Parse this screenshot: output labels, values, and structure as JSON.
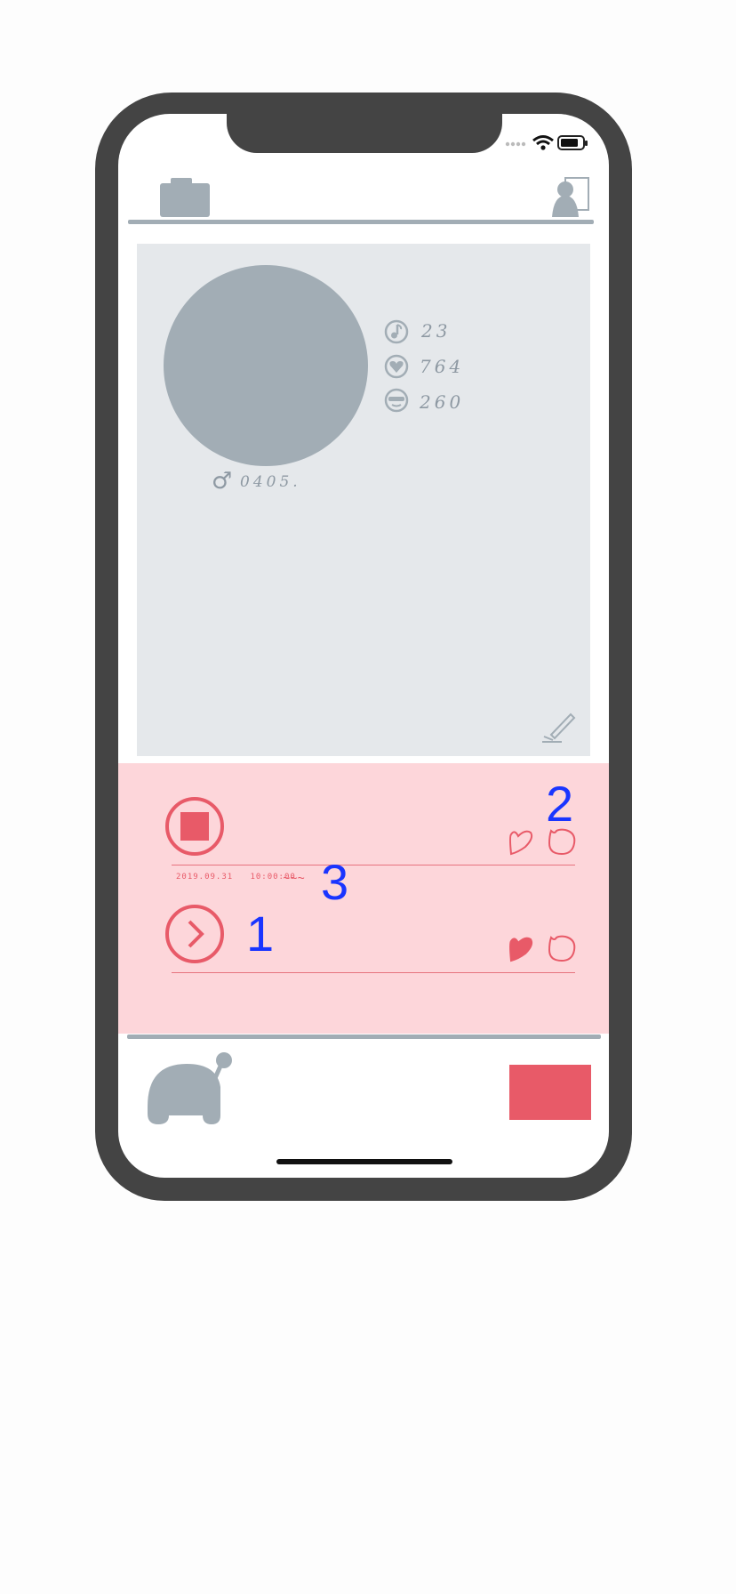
{
  "status_bar": {
    "signal_icon": "signal-dots-icon",
    "wifi_icon": "wifi-icon",
    "battery_icon": "battery-icon"
  },
  "top_bar": {
    "left_icon": "camera-icon",
    "right_icon": "logout-user-icon"
  },
  "profile": {
    "stats": [
      {
        "icon": "music-note-icon",
        "value": "23"
      },
      {
        "icon": "heart-icon",
        "value": "764"
      },
      {
        "icon": "glasses-face-icon",
        "value": "260"
      }
    ],
    "gender_symbol": "♂",
    "user_tag": "0405."
  },
  "tracks": [
    {
      "state": "stop",
      "annotation": "2",
      "liked": false
    },
    {
      "timestamp": "2019.09.31   10:00:00",
      "scribble": "~~~",
      "annotation": "3"
    },
    {
      "state": "play",
      "annotation": "1",
      "liked": true
    }
  ],
  "colors": {
    "accent": "#e85a68",
    "gray": "#a2adb5",
    "panel": "#e5e8eb",
    "list_bg": "#fdd6da",
    "frame": "#444444",
    "annotation": "#1a35ff"
  }
}
